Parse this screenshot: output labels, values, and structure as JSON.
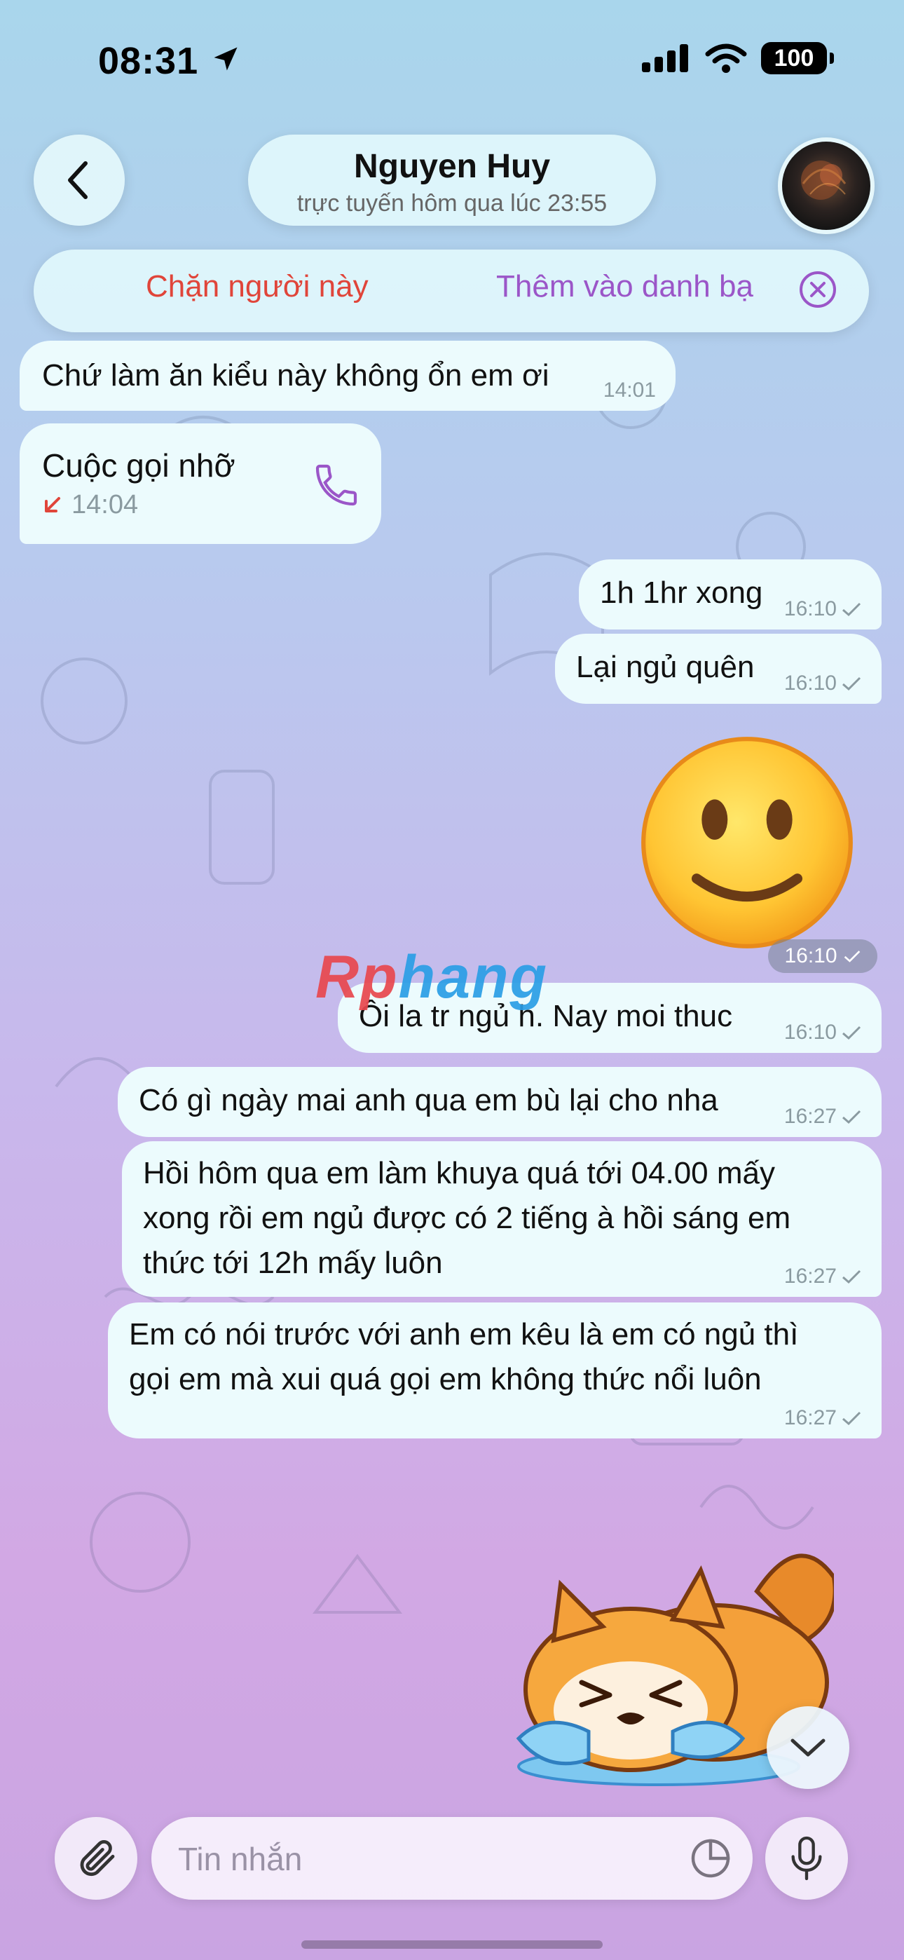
{
  "status_bar": {
    "time": "08:31",
    "battery": "100"
  },
  "header": {
    "contact_name": "Nguyen Huy",
    "last_seen": "trực tuyến hôm qua lúc 23:55"
  },
  "actions": {
    "block_label": "Chặn người này",
    "add_contact_label": "Thêm vào danh bạ"
  },
  "messages": [
    {
      "direction": "in",
      "text": "Chứ làm ăn kiểu này không ổn em ơi",
      "time": "14:01"
    },
    {
      "direction": "in",
      "type": "missed-call",
      "title": "Cuộc gọi nhỡ",
      "time": "14:04"
    },
    {
      "direction": "out",
      "text": "1h 1hr xong",
      "time": "16:10"
    },
    {
      "direction": "out",
      "text": "Lại ngủ quên",
      "time": "16:10"
    },
    {
      "direction": "out",
      "type": "emoji",
      "emoji": "slightly-smiling-face",
      "time": "16:10"
    },
    {
      "direction": "out",
      "text": "Ôi la tr ngủ h. Nay moi thuc",
      "time": "16:10"
    },
    {
      "direction": "out",
      "text": "Có gì ngày mai anh qua em bù lại cho nha",
      "time": "16:27"
    },
    {
      "direction": "out",
      "lines": [
        "Hồi hôm qua em làm khuya quá tới 04.00 mấy",
        "xong rồi em ngủ được có 2 tiếng à hồi sáng em",
        "thức tới 12h mấy luôn"
      ],
      "time": "16:27"
    },
    {
      "direction": "out",
      "lines": [
        "Em có nói trước với anh em kêu là em có ngủ thì",
        "gọi em mà xui quá gọi em không thức nổi luôn"
      ],
      "time": "16:27"
    },
    {
      "direction": "out",
      "type": "sticker",
      "sticker": "crying-shiba-sticker"
    }
  ],
  "watermark": {
    "part1": "Rp",
    "part2": "hang"
  },
  "composer": {
    "placeholder": "Tin nhắn"
  },
  "colors": {
    "block": "#e0453a",
    "accent": "#9b56c8",
    "bubble": "#ecfbfd",
    "meta": "#8a9aa0"
  }
}
